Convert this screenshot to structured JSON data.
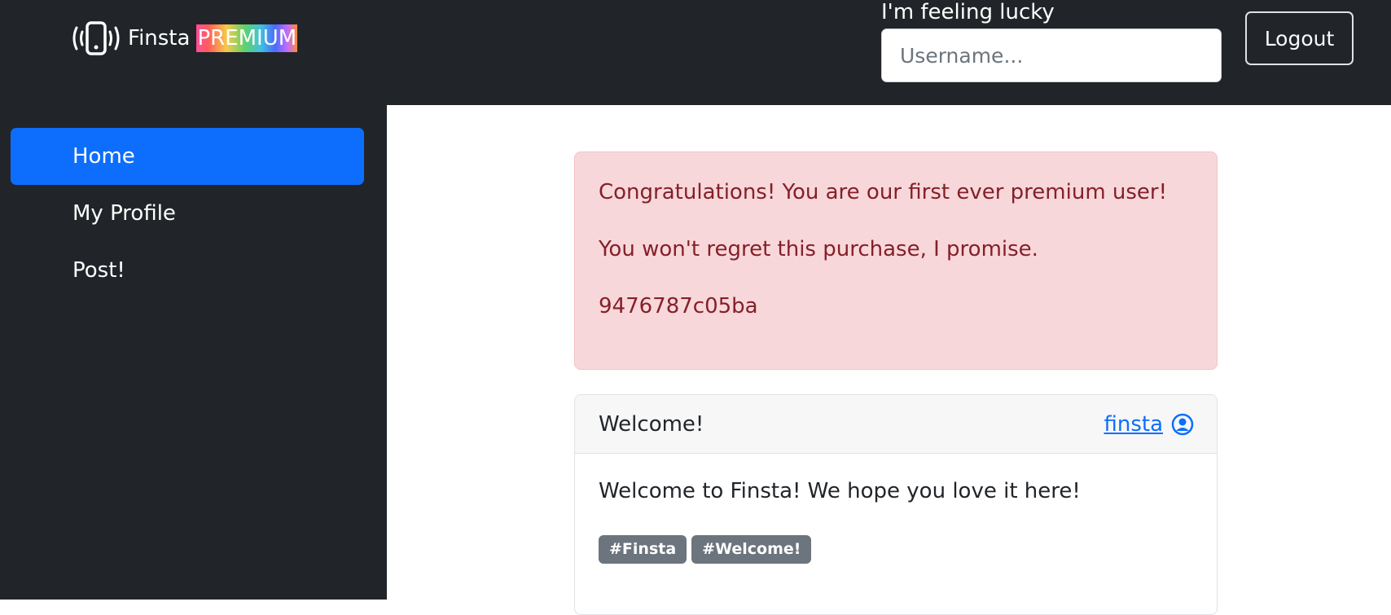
{
  "header": {
    "brand_name": "Finsta",
    "brand_badge": "PREMIUM",
    "lucky_label": "I'm feeling lucky",
    "search_placeholder": "Username...",
    "logout_label": "Logout"
  },
  "sidebar": {
    "items": [
      {
        "label": "Home",
        "active": true
      },
      {
        "label": "My Profile",
        "active": false
      },
      {
        "label": "Post!",
        "active": false
      }
    ]
  },
  "alert": {
    "lines": [
      "Congratulations! You are our first ever premium user!",
      "You won't regret this purchase, I promise.",
      "9476787c05ba"
    ]
  },
  "post": {
    "title": "Welcome!",
    "author": "finsta",
    "body": "Welcome to Finsta! We hope you love it here!",
    "tags": [
      "#Finsta",
      "#Welcome!"
    ]
  },
  "colors": {
    "navbar_bg": "#212529",
    "accent": "#0d6efd",
    "alert_bg": "#f8d7da",
    "alert_text": "#842029",
    "tag_bg": "#6c757d"
  },
  "icons": {
    "brand": "phone-vibrate-icon",
    "author": "person-circle-icon"
  }
}
